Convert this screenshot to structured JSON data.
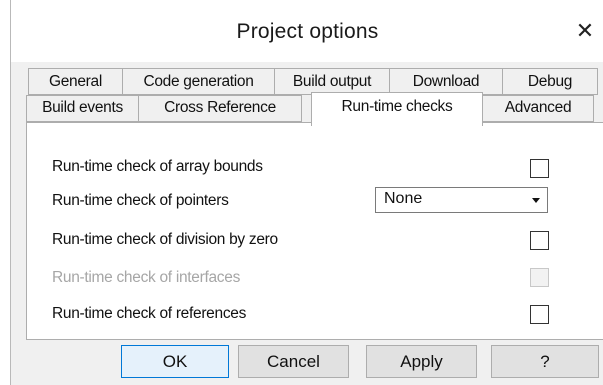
{
  "window": {
    "title": "Project options",
    "close_glyph": "✕"
  },
  "tabs": {
    "row1": [
      {
        "label": "General"
      },
      {
        "label": "Code generation"
      },
      {
        "label": "Build output"
      },
      {
        "label": "Download"
      },
      {
        "label": "Debug"
      }
    ],
    "row2": [
      {
        "label": "Build events"
      },
      {
        "label": "Cross Reference"
      },
      {
        "label": "Run-time checks",
        "active": true
      },
      {
        "label": "Advanced"
      }
    ]
  },
  "options": [
    {
      "label": "Run-time check of array bounds",
      "control": "checkbox",
      "checked": false,
      "enabled": true
    },
    {
      "label": "Run-time check of pointers",
      "control": "select",
      "value": "None",
      "enabled": true
    },
    {
      "label": "Run-time check of division by zero",
      "control": "checkbox",
      "checked": false,
      "enabled": true
    },
    {
      "label": "Run-time check of interfaces",
      "control": "checkbox",
      "checked": false,
      "enabled": false
    },
    {
      "label": "Run-time check of references",
      "control": "checkbox",
      "checked": false,
      "enabled": true
    }
  ],
  "buttons": {
    "ok": "OK",
    "cancel": "Cancel",
    "apply": "Apply",
    "help": "?"
  },
  "colors": {
    "dialog_bg": "#f0f0f0",
    "panel_bg": "#ffffff",
    "disabled_text": "#a6a6a6",
    "default_button_border": "#0078d7"
  }
}
